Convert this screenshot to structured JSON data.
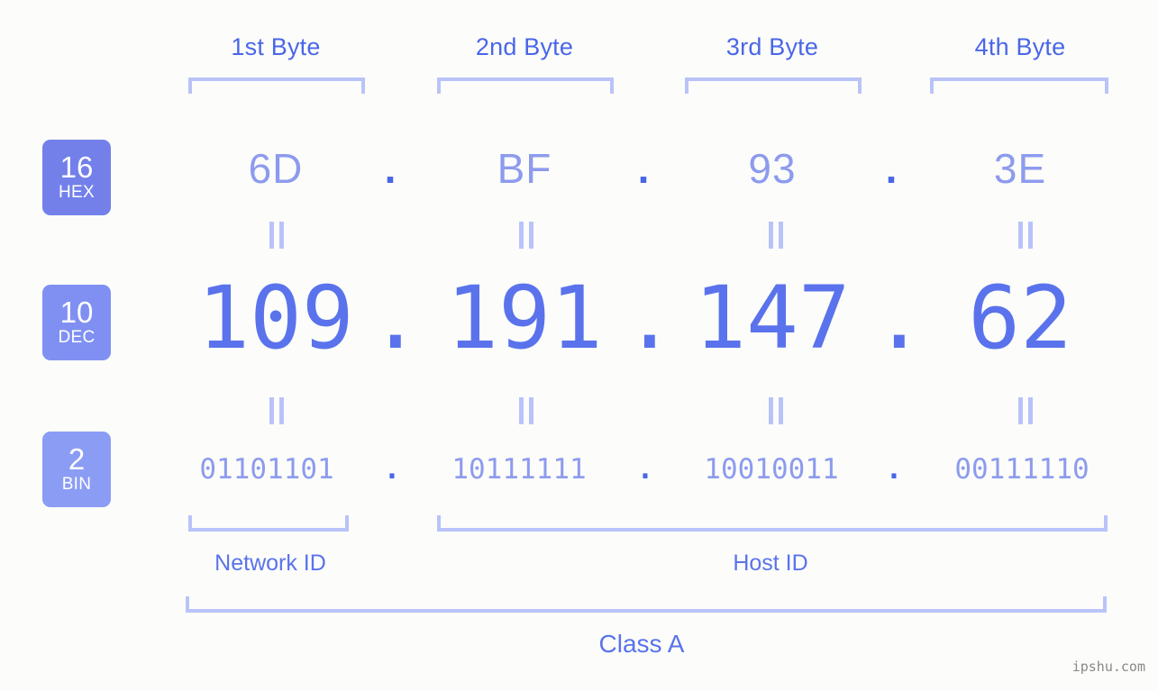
{
  "page": {
    "background": "#fcfdfa",
    "accent_strong": "#4a66e8",
    "accent_mid": "#5a73ec",
    "accent_light": "#8d9bee",
    "accent_pale": "#b9c3f9",
    "watermark": "ipshu.com"
  },
  "byte_headers": [
    {
      "label": "1st Byte"
    },
    {
      "label": "2nd Byte"
    },
    {
      "label": "3rd Byte"
    },
    {
      "label": "4th Byte"
    }
  ],
  "rows": {
    "hex": {
      "badge_num": "16",
      "badge_sub": "HEX",
      "badge_color": "#7380ea",
      "values": [
        "6D",
        "BF",
        "93",
        "3E"
      ],
      "separator": "."
    },
    "dec": {
      "badge_num": "10",
      "badge_sub": "DEC",
      "badge_color": "#8090f2",
      "values": [
        "109",
        "191",
        "147",
        "62"
      ],
      "separator": "."
    },
    "bin": {
      "badge_num": "2",
      "badge_sub": "BIN",
      "badge_color": "#8b9cf5",
      "values": [
        "01101101",
        "10111111",
        "10010011",
        "00111110"
      ],
      "separator": "."
    }
  },
  "equals_symbol": "=",
  "id_sections": [
    {
      "label": "Network ID"
    },
    {
      "label": "Host ID"
    }
  ],
  "class_label": "Class A"
}
